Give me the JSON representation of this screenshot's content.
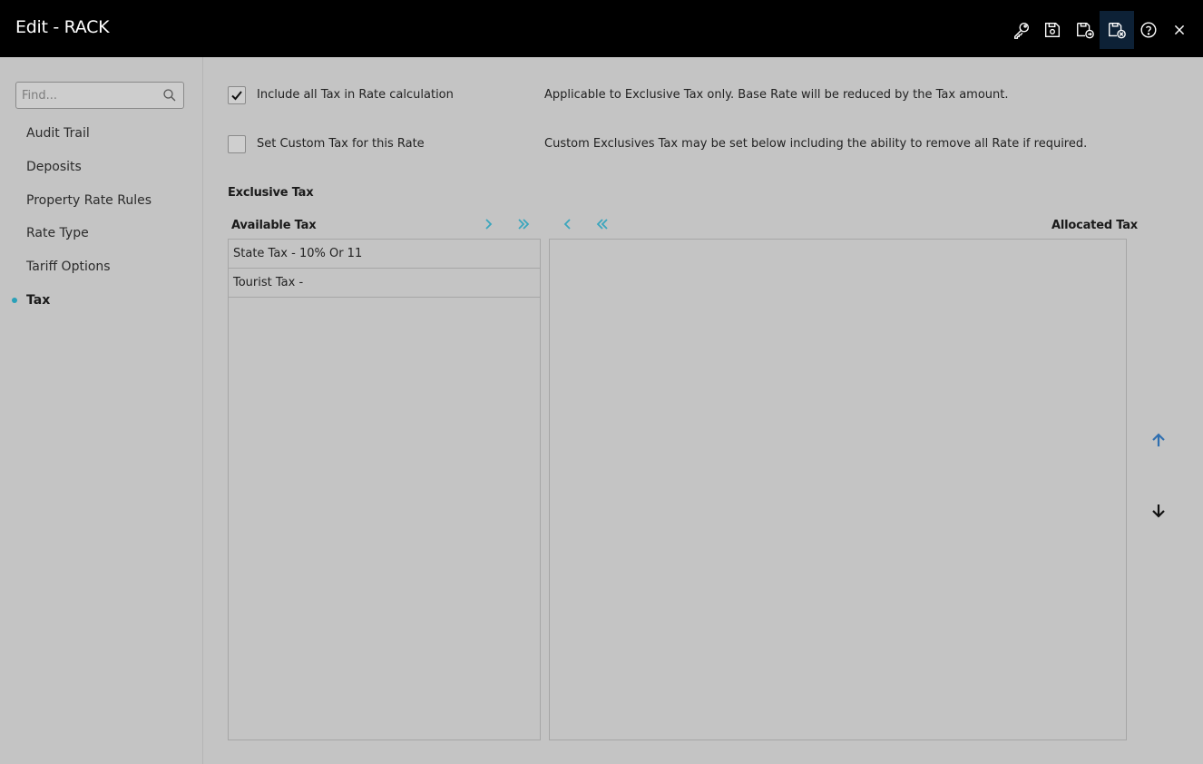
{
  "window": {
    "title": "Edit - RACK"
  },
  "toolbar": {
    "icons": [
      "key-icon",
      "save-icon",
      "save-and-new-icon",
      "save-and-close-icon",
      "help-icon",
      "close-icon"
    ]
  },
  "sidebar": {
    "search": {
      "placeholder": "Find...",
      "value": ""
    },
    "items": [
      {
        "label": "Audit Trail"
      },
      {
        "label": "Deposits"
      },
      {
        "label": "Property Rate Rules"
      },
      {
        "label": "Rate Type"
      },
      {
        "label": "Tariff Options"
      },
      {
        "label": "Tax",
        "active": true
      }
    ]
  },
  "main": {
    "include_tax": {
      "label": "Include all Tax in Rate calculation",
      "checked": true,
      "description": "Applicable to Exclusive Tax only. Base Rate will be reduced by the Tax amount."
    },
    "custom_tax": {
      "label": "Set Custom Tax for this Rate",
      "checked": false,
      "description": "Custom Exclusives Tax may be set below including the ability to remove all Rate if required."
    },
    "exclusive_tax": {
      "title": "Exclusive Tax",
      "available_label": "Available Tax",
      "allocated_label": "Allocated Tax",
      "available_items": [
        "State Tax - 10% Or 11",
        "Tourist Tax -"
      ],
      "allocated_items": []
    }
  },
  "colors": {
    "accent": "#2aa0b8",
    "arrow": "#3aa6bd",
    "up_arrow": "#2f6fb0",
    "titlebar": "#000000",
    "background": "#c4c4c4"
  }
}
